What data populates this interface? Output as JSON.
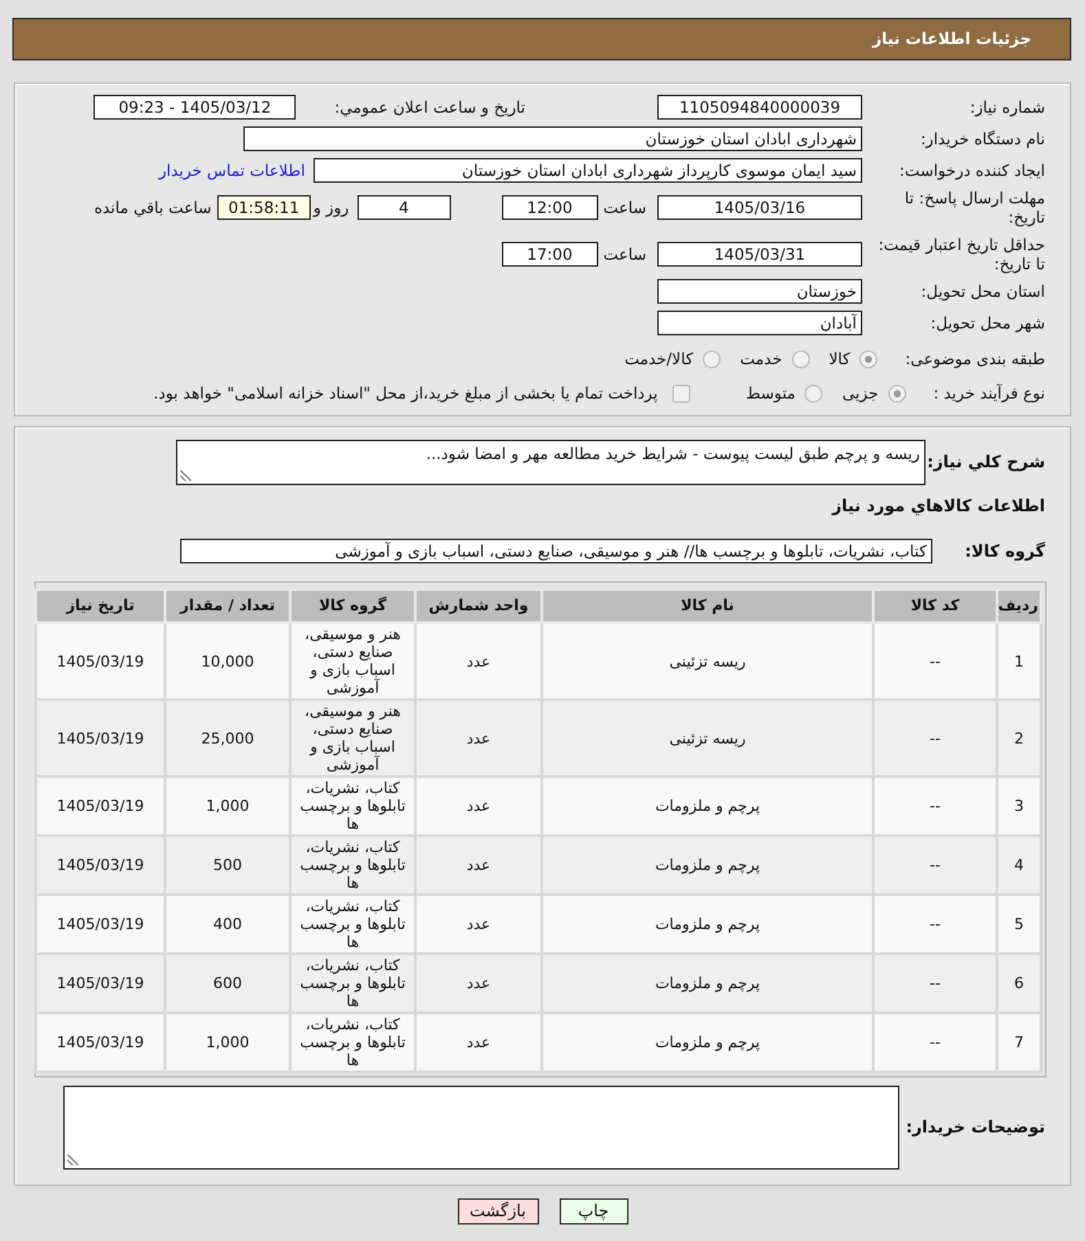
{
  "header": {
    "title": "جزئیات اطلاعات نیاز"
  },
  "form": {
    "need_number": {
      "label": "شماره نیاز:",
      "value": "1105094840000039"
    },
    "announce": {
      "label": "تاریخ و ساعت اعلان عمومي:",
      "value": "1405/03/12 - 09:23"
    },
    "buyer_org": {
      "label": "نام دستگاه خریدار:",
      "value": "شهرداری ابادان استان خوزستان"
    },
    "requester": {
      "label": "ایجاد کننده درخواست:",
      "value": "سید ایمان موسوی کارپرداز شهرداری ابادان استان خوزستان",
      "link": "اطلاعات تماس خریدار"
    },
    "response_deadline": {
      "label": "مهلت ارسال پاسخ: تا تاریخ:",
      "date": "1405/03/16",
      "time_label": "ساعت",
      "time": "12:00",
      "days": "4",
      "days_label": "روز و",
      "remaining": "01:58:11",
      "remaining_label": "ساعت باقي مانده"
    },
    "price_validity": {
      "label": "حداقل تاریخ اعتبار قیمت: تا تاریخ:",
      "date": "1405/03/31",
      "time_label": "ساعت",
      "time": "17:00"
    },
    "province": {
      "label": "استان محل تحویل:",
      "value": "خوزستان"
    },
    "city": {
      "label": "شهر محل تحویل:",
      "value": "آبادان"
    },
    "category": {
      "label": "طبقه بندی موضوعی:",
      "options": [
        {
          "label": "کالا",
          "selected": true,
          "disabled": true
        },
        {
          "label": "خدمت",
          "selected": false,
          "disabled": true
        },
        {
          "label": "کالا/خدمت",
          "selected": false,
          "disabled": true
        }
      ]
    },
    "purchase_type": {
      "label": "نوع فرآیند خرید :",
      "options": [
        {
          "label": "جزیی",
          "selected": true,
          "disabled": true
        },
        {
          "label": "متوسط",
          "selected": false,
          "disabled": true
        }
      ],
      "treasury": {
        "label": "پرداخت تمام یا بخشی از مبلغ خرید،از محل \"اسناد خزانه اسلامی\" خواهد بود.",
        "checked": false,
        "disabled": true
      }
    }
  },
  "description": {
    "label": "شرح کلي نیاز:",
    "value": "ریسه و پرچم طبق لیست پیوست - شرایط خرید مطالعه مهر و امضا شود..."
  },
  "goods": {
    "heading": "اطلاعات کالاهاي مورد نیاز",
    "group_label": "گروه کالا:",
    "group_value": "کتاب، نشریات، تابلوها و برچسب ها// هنر و موسیقی، صنایع دستی، اسباب بازی و آموزشی"
  },
  "table": {
    "columns": [
      "ردیف",
      "کد کالا",
      "نام کالا",
      "واحد شمارش",
      "گروه کالا",
      "تعداد / مقدار",
      "تاریخ نیاز"
    ],
    "rows": [
      [
        "1",
        "--",
        "ریسه تزئینی",
        "عدد",
        "هنر و موسیقی، صنایع دستی، اسباب بازی و آموزشی",
        "10,000",
        "1405/03/19"
      ],
      [
        "2",
        "--",
        "ریسه تزئینی",
        "عدد",
        "هنر و موسیقی، صنایع دستی، اسباب بازی و آموزشی",
        "25,000",
        "1405/03/19"
      ],
      [
        "3",
        "--",
        "پرچم و ملزومات",
        "عدد",
        "کتاب، نشریات، تابلوها و برچسب ها",
        "1,000",
        "1405/03/19"
      ],
      [
        "4",
        "--",
        "پرچم و ملزومات",
        "عدد",
        "کتاب، نشریات، تابلوها و برچسب ها",
        "500",
        "1405/03/19"
      ],
      [
        "5",
        "--",
        "پرچم و ملزومات",
        "عدد",
        "کتاب، نشریات، تابلوها و برچسب ها",
        "400",
        "1405/03/19"
      ],
      [
        "6",
        "--",
        "پرچم و ملزومات",
        "عدد",
        "کتاب، نشریات، تابلوها و برچسب ها",
        "600",
        "1405/03/19"
      ],
      [
        "7",
        "--",
        "پرچم و ملزومات",
        "عدد",
        "کتاب، نشریات، تابلوها و برچسب ها",
        "1,000",
        "1405/03/19"
      ]
    ]
  },
  "buyer_notes": {
    "label": "توضیحات خریدار:"
  },
  "buttons": [
    {
      "label": "چاپ",
      "kind": "print"
    },
    {
      "label": "بازگشت",
      "kind": "back"
    }
  ]
}
